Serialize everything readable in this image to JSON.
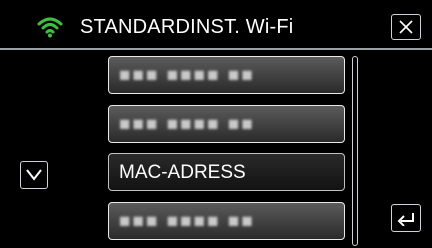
{
  "header": {
    "title": "STANDARDINST. Wi-Fi",
    "status_icon": "wifi-icon",
    "close_icon": "close-icon",
    "accent_color": "#3fbf3f"
  },
  "list": {
    "items": [
      {
        "label": "■■■ ■■■■ ■■",
        "obscured": true
      },
      {
        "label": "■■■ ■■■■ ■■",
        "obscured": true
      },
      {
        "label": "MAC-ADRESS",
        "obscured": false,
        "selected": true
      },
      {
        "label": "■■■ ■■■■ ■■",
        "obscured": true
      }
    ]
  },
  "controls": {
    "down_icon": "chevron-down-icon",
    "back_icon": "return-arrow-icon"
  }
}
